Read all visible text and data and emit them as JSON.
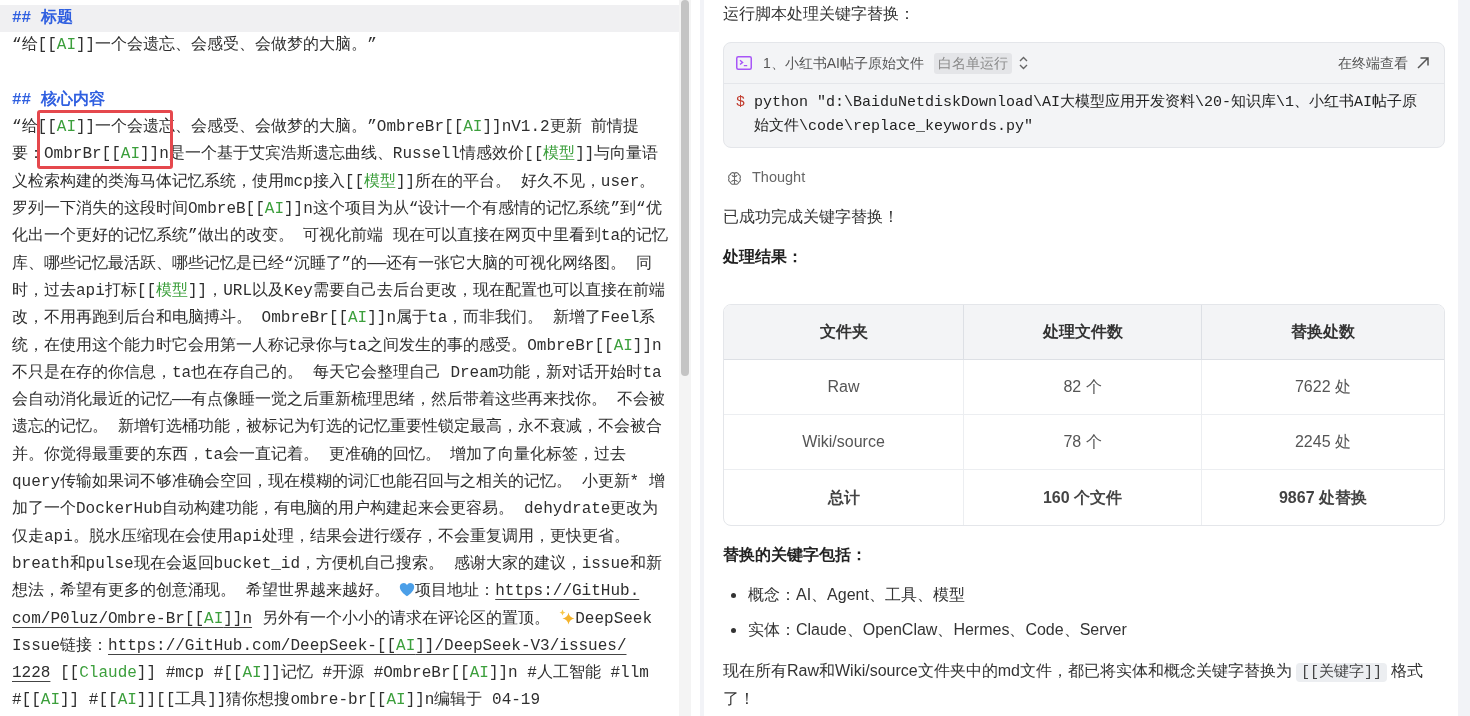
{
  "editor": {
    "lines": [
      {
        "kind": "heading",
        "current": true,
        "segments": [
          {
            "kind": "text",
            "parts": [
              {
                "kind": "plain",
                "text": "## 标题"
              }
            ]
          }
        ]
      },
      {
        "kind": "body",
        "current": false,
        "segments": [
          {
            "kind": "text",
            "parts": [
              {
                "kind": "plain",
                "text": "“给[["
              },
              {
                "kind": "wiki",
                "text": "AI"
              },
              {
                "kind": "plain",
                "text": "]]一个会遗忘、会感受、会做梦的大脑。”"
              }
            ]
          }
        ]
      },
      {
        "kind": "blank",
        "current": false
      },
      {
        "kind": "heading",
        "current": false,
        "segments": [
          {
            "kind": "text",
            "parts": [
              {
                "kind": "plain",
                "text": "## 核心内容"
              }
            ]
          }
        ]
      },
      {
        "kind": "body",
        "current": false,
        "segments": [
          {
            "kind": "text",
            "parts": [
              {
                "kind": "plain",
                "text": "“给[["
              },
              {
                "kind": "wiki",
                "text": "AI"
              },
              {
                "kind": "plain",
                "text": "]]一个会遗忘、会感受、会做梦的大脑。”OmbreBr[["
              },
              {
                "kind": "wiki",
                "text": "AI"
              },
              {
                "kind": "plain",
                "text": "]]nV1.2更新 前情提"
              }
            ]
          }
        ]
      },
      {
        "kind": "body",
        "current": false,
        "segments": [
          {
            "kind": "text",
            "parts": [
              {
                "kind": "plain",
                "text": "要：OmbrBr[["
              },
              {
                "kind": "wiki",
                "text": "AI"
              },
              {
                "kind": "plain",
                "text": "]]n是一个基于艾宾浩斯遗忘曲线、Russell情感效价[["
              },
              {
                "kind": "wiki",
                "text": "模型"
              },
              {
                "kind": "plain",
                "text": "]]与向量语"
              }
            ]
          }
        ]
      },
      {
        "kind": "body",
        "current": false,
        "segments": [
          {
            "kind": "text",
            "parts": [
              {
                "kind": "plain",
                "text": "义检索构建的类海马体记忆系统，使用mcp接入[["
              },
              {
                "kind": "wiki",
                "text": "模型"
              },
              {
                "kind": "plain",
                "text": "]]所在的平台。 好久不见，user。"
              }
            ]
          }
        ]
      },
      {
        "kind": "body",
        "current": false,
        "segments": [
          {
            "kind": "text",
            "parts": [
              {
                "kind": "plain",
                "text": "罗列一下消失的这段时间OmbreB[["
              },
              {
                "kind": "wiki",
                "text": "AI"
              },
              {
                "kind": "plain",
                "text": "]]n这个项目为从“设计一个有感情的记忆系统”到“优"
              }
            ]
          }
        ]
      },
      {
        "kind": "body",
        "current": false,
        "segments": [
          {
            "kind": "text",
            "parts": [
              {
                "kind": "plain",
                "text": "化出一个更好的记忆系统”做出的改变。 可视化前端 现在可以直接在网页中里看到ta的记忆"
              }
            ]
          }
        ]
      },
      {
        "kind": "body",
        "current": false,
        "segments": [
          {
            "kind": "text",
            "parts": [
              {
                "kind": "plain",
                "text": "库、哪些记忆最活跃、哪些记忆是已经“沉睡了”的——还有一张它大脑的可视化网络图。 同"
              }
            ]
          }
        ]
      },
      {
        "kind": "body",
        "current": false,
        "segments": [
          {
            "kind": "text",
            "parts": [
              {
                "kind": "plain",
                "text": "时，过去api打标[["
              },
              {
                "kind": "wiki",
                "text": "模型"
              },
              {
                "kind": "plain",
                "text": "]]，URL以及Key需要自己去后台更改，现在配置也可以直接在前端"
              }
            ]
          }
        ]
      },
      {
        "kind": "body",
        "current": false,
        "segments": [
          {
            "kind": "text",
            "parts": [
              {
                "kind": "plain",
                "text": "改，不用再跑到后台和电脑搏斗。 OmbreBr[["
              },
              {
                "kind": "wiki",
                "text": "AI"
              },
              {
                "kind": "plain",
                "text": "]]n属于ta，而非我们。 新增了Feel系"
              }
            ]
          }
        ]
      },
      {
        "kind": "body",
        "current": false,
        "segments": [
          {
            "kind": "text",
            "parts": [
              {
                "kind": "plain",
                "text": "统，在使用这个能力时它会用第一人称记录你与ta之间发生的事的感受。OmbreBr[["
              },
              {
                "kind": "wiki",
                "text": "AI"
              },
              {
                "kind": "plain",
                "text": "]]n"
              }
            ]
          }
        ]
      },
      {
        "kind": "body",
        "current": false,
        "segments": [
          {
            "kind": "text",
            "parts": [
              {
                "kind": "plain",
                "text": "不只是在存的你信息，ta也在存自己的。 每天它会整理自己 Dream功能，新对话开始时ta"
              }
            ]
          }
        ]
      },
      {
        "kind": "body",
        "current": false,
        "segments": [
          {
            "kind": "text",
            "parts": [
              {
                "kind": "plain",
                "text": "会自动消化最近的记忆——有点像睡一觉之后重新梳理思绪，然后带着这些再来找你。 不会被"
              }
            ]
          }
        ]
      },
      {
        "kind": "body",
        "current": false,
        "segments": [
          {
            "kind": "text",
            "parts": [
              {
                "kind": "plain",
                "text": "遗忘的记忆。 新增钉选桶功能，被标记为钉选的记忆重要性锁定最高，永不衰减，不会被合"
              }
            ]
          }
        ]
      },
      {
        "kind": "body",
        "current": false,
        "segments": [
          {
            "kind": "text",
            "parts": [
              {
                "kind": "plain",
                "text": "并。你觉得最重要的东西，ta会一直记着。 更准确的回忆。 增加了向量化标签，过去"
              }
            ]
          }
        ]
      },
      {
        "kind": "body",
        "current": false,
        "segments": [
          {
            "kind": "text",
            "parts": [
              {
                "kind": "plain",
                "text": "query传输如果词不够准确会空回，现在模糊的词汇也能召回与之相关的记忆。 小更新* 增"
              }
            ]
          }
        ]
      },
      {
        "kind": "body",
        "current": false,
        "segments": [
          {
            "kind": "text",
            "parts": [
              {
                "kind": "plain",
                "text": "加了一个DockerHub自动构建功能，有电脑的用户构建起来会更容易。 dehydrate更改为"
              }
            ]
          }
        ]
      },
      {
        "kind": "body",
        "current": false,
        "segments": [
          {
            "kind": "text",
            "parts": [
              {
                "kind": "plain",
                "text": "仅走api。脱水压缩现在会使用api处理，结果会进行缓存，不会重复调用，更快更省。"
              }
            ]
          }
        ]
      },
      {
        "kind": "body",
        "current": false,
        "segments": [
          {
            "kind": "text",
            "parts": [
              {
                "kind": "plain",
                "text": "breath和pulse现在会返回bucket_id，方便机自己搜索。 感谢大家的建议，issue和新"
              }
            ]
          }
        ]
      },
      {
        "kind": "body",
        "current": false,
        "segments": [
          {
            "kind": "text",
            "parts": [
              {
                "kind": "plain",
                "text": "想法，希望有更多的创意涌现。 希望世界越来越好。 "
              }
            ]
          },
          {
            "kind": "heart"
          },
          {
            "kind": "text",
            "parts": [
              {
                "kind": "plain",
                "text": "项目地址："
              }
            ]
          },
          {
            "kind": "link",
            "parts": [
              {
                "kind": "plain",
                "text": "https://GitHub."
              }
            ]
          }
        ]
      },
      {
        "kind": "body",
        "current": false,
        "segments": [
          {
            "kind": "link",
            "parts": [
              {
                "kind": "plain",
                "text": "com/P0luz/Ombre-Br[["
              },
              {
                "kind": "wiki",
                "text": "AI"
              },
              {
                "kind": "plain",
                "text": "]]n"
              }
            ]
          },
          {
            "kind": "text",
            "parts": [
              {
                "kind": "plain",
                "text": " 另外有一个小小的请求在评论区的置顶。 "
              }
            ]
          },
          {
            "kind": "sparkle"
          },
          {
            "kind": "text",
            "parts": [
              {
                "kind": "plain",
                "text": "DeepSeek"
              }
            ]
          }
        ]
      },
      {
        "kind": "body",
        "current": false,
        "segments": [
          {
            "kind": "text",
            "parts": [
              {
                "kind": "plain",
                "text": "Issue链接："
              }
            ]
          },
          {
            "kind": "link",
            "parts": [
              {
                "kind": "plain",
                "text": "https://GitHub.com/DeepSeek-[["
              },
              {
                "kind": "wiki",
                "text": "AI"
              },
              {
                "kind": "plain",
                "text": "]]/DeepSeek-V3/issues/"
              }
            ]
          }
        ]
      },
      {
        "kind": "body",
        "current": false,
        "segments": [
          {
            "kind": "link",
            "parts": [
              {
                "kind": "plain",
                "text": "1228"
              }
            ]
          },
          {
            "kind": "text",
            "parts": [
              {
                "kind": "plain",
                "text": " [["
              },
              {
                "kind": "wiki",
                "text": "Claude"
              },
              {
                "kind": "plain",
                "text": "]] #mcp #[["
              },
              {
                "kind": "wiki",
                "text": "AI"
              },
              {
                "kind": "plain",
                "text": "]]记忆 #开源 #OmbreBr[["
              },
              {
                "kind": "wiki",
                "text": "AI"
              },
              {
                "kind": "plain",
                "text": "]]n #人工智能 #llm"
              }
            ]
          }
        ]
      },
      {
        "kind": "body",
        "current": false,
        "segments": [
          {
            "kind": "text",
            "parts": [
              {
                "kind": "plain",
                "text": "#[["
              },
              {
                "kind": "wiki",
                "text": "AI"
              },
              {
                "kind": "plain",
                "text": "]] #[["
              },
              {
                "kind": "wiki",
                "text": "AI"
              },
              {
                "kind": "plain",
                "text": "]][[工具]]猜你想搜ombre-br[["
              },
              {
                "kind": "wiki",
                "text": "AI"
              },
              {
                "kind": "plain",
                "text": "]]n编辑于 04-19"
              }
            ]
          }
        ]
      }
    ]
  },
  "chat": {
    "intro": "运行脚本处理关键字替换：",
    "terminal": {
      "title": "1、小红书AI帖子原始文件",
      "badge": "白名单运行",
      "open_link": "在终端查看",
      "prompt": "$",
      "command": "python \"d:\\BaiduNetdiskDownload\\AI大模型应用开发资料\\20-知识库\\1、小红书AI帖子原始文件\\code\\replace_keywords.py\""
    },
    "thought": "Thought",
    "result": "已成功完成关键字替换！",
    "results_heading": "处理结果：",
    "table": {
      "columns": [
        "文件夹",
        "处理文件数",
        "替换处数"
      ],
      "rows": [
        {
          "kind": "data",
          "cells": [
            "Raw",
            "82 个",
            "7622 处"
          ]
        },
        {
          "kind": "data",
          "cells": [
            "Wiki/source",
            "78 个",
            "2245 处"
          ]
        },
        {
          "kind": "total",
          "cells": [
            "总计",
            "160 个文件",
            "9867 处替换"
          ]
        }
      ]
    },
    "keywords_heading": "替换的关键字包括：",
    "keywords": [
      "概念：AI、Agent、工具、模型",
      "实体：Claude、OpenClaw、Hermes、Code、Server"
    ],
    "summary": [
      {
        "kind": "plain",
        "text": "现在所有Raw和Wiki/source文件夹中的md文件，都已将实体和概念关键字替换为"
      },
      {
        "kind": "code",
        "text": "[[关键字]]"
      },
      {
        "kind": "plain",
        "text": "格式了！"
      }
    ]
  }
}
